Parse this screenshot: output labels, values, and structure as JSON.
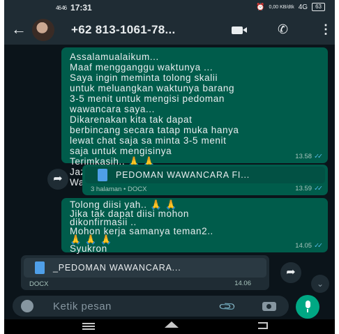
{
  "status_bar": {
    "signal": "46 46",
    "time": "17:31",
    "speed": "0,00 KB/dtk",
    "network": "4G",
    "battery": "63"
  },
  "header": {
    "back_icon": "arrow-left-icon",
    "contact_name": "+62 813-1061-78...",
    "icons": [
      "video-call-icon",
      "phone-icon",
      "more-vert-icon"
    ]
  },
  "messages": [
    {
      "type": "text",
      "direction": "outgoing",
      "text": "Assalamualaikum...\nMaaf mengganggu waktunya ...\nSaya ingin meminta tolong skalii\nuntuk meluangkan waktunya barang\n3-5 menit untuk mengisi pedoman\nwawancara saya...\nDikarenakan kita tak dapat\nberbincang secara tatap muka hanya\nlewat chat saja sa minta 3-5 menit\nsaja untuk mengisinya\nTerimkasih.. 🙏 🙏\nJazakallah khair/jazakillah khair...\nWassalam",
      "time": "13.58",
      "ticks": "✓✓"
    },
    {
      "type": "document",
      "direction": "outgoing",
      "file_name": "PEDOMAN WAWANCARA FI...",
      "meta": "3 halaman • DOCX",
      "time": "13.59",
      "ticks": "✓✓"
    },
    {
      "type": "text",
      "direction": "outgoing",
      "text": "Tolong diisi yah.. 🙏 🙏\nJika tak dapat diisi mohon\ndikonfirmasii ..\nMohon kerja samanya teman2..\n🙏 🙏 🙏\nSyukron",
      "time": "14.05",
      "ticks": "✓✓"
    },
    {
      "type": "document",
      "direction": "incoming",
      "file_name": "_PEDOMAN WAWANCARA...",
      "meta": "DOCX",
      "time": "14.06"
    }
  ],
  "input": {
    "placeholder": "Ketik pesan",
    "icons": [
      "emoji-icon",
      "attach-icon",
      "camera-icon",
      "mic-icon"
    ]
  },
  "navbar": {
    "icons": [
      "recent-apps-icon",
      "home-icon",
      "back-icon"
    ]
  },
  "colors": {
    "outgoing_bubble": "#005c4b",
    "incoming_bubble": "#1f2c34",
    "accent": "#00a884",
    "read_ticks": "#53bdeb"
  }
}
